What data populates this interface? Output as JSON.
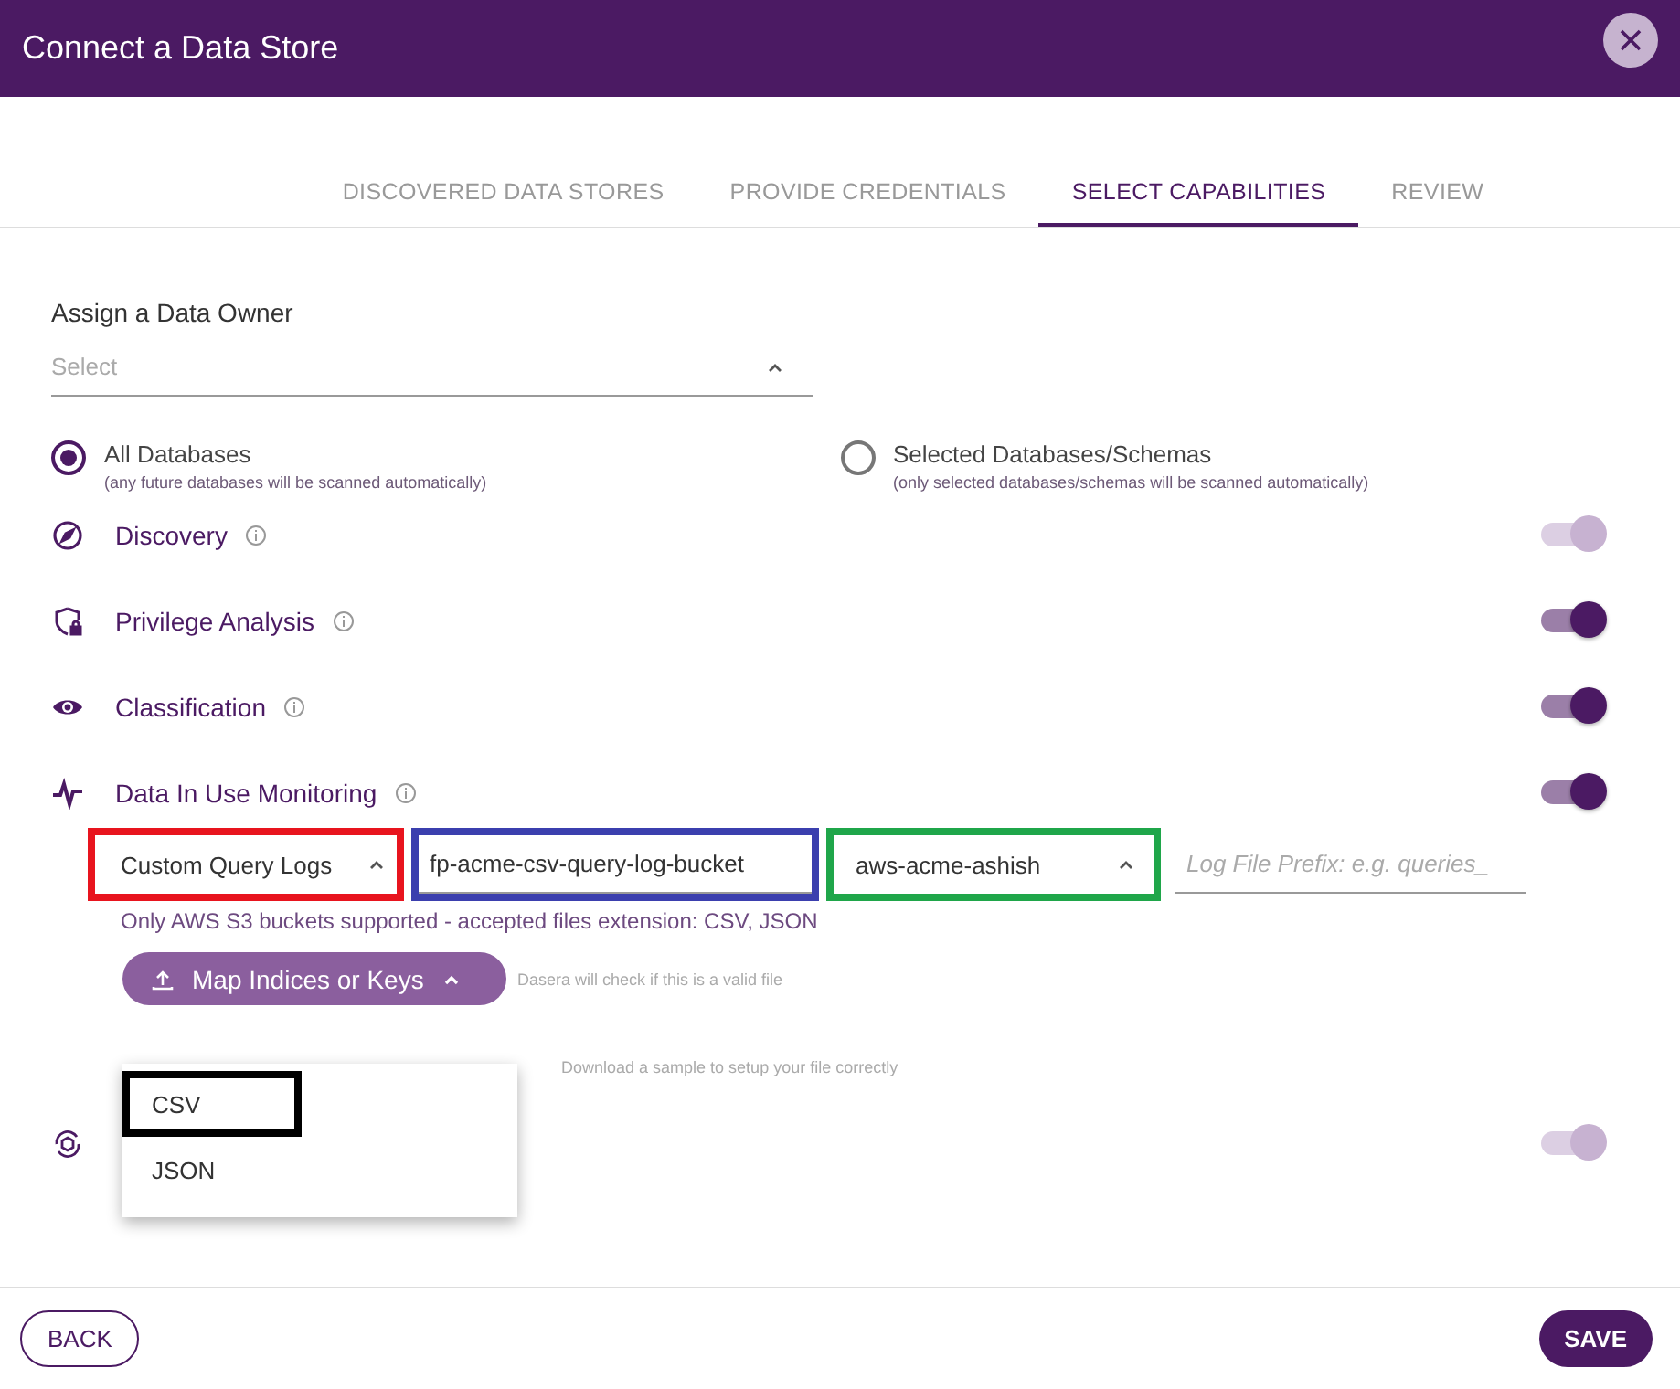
{
  "dialog": {
    "title": "Connect a Data Store"
  },
  "tabs": [
    {
      "label": "DISCOVERED DATA STORES",
      "selected": false
    },
    {
      "label": "PROVIDE CREDENTIALS",
      "selected": false
    },
    {
      "label": "SELECT CAPABILITIES",
      "selected": true
    },
    {
      "label": "REVIEW",
      "selected": false
    }
  ],
  "owner": {
    "label": "Assign a Data Owner",
    "placeholder": "Select"
  },
  "scope": [
    {
      "label": "All Databases",
      "note": "(any future databases will be scanned automatically)",
      "selected": true
    },
    {
      "label": "Selected Databases/Schemas",
      "note": "(only selected databases/schemas will be scanned automatically)",
      "selected": false
    }
  ],
  "capabilities": [
    {
      "label": "Discovery",
      "info": true,
      "on": true,
      "disabled": true
    },
    {
      "label": "Privilege Analysis",
      "info": true,
      "on": true,
      "disabled": false
    },
    {
      "label": "Classification",
      "info": true,
      "on": true,
      "disabled": false
    },
    {
      "label": "Data In Use Monitoring",
      "info": true,
      "on": true,
      "disabled": false,
      "config": true
    },
    {
      "on": true,
      "disabled": true
    }
  ],
  "monitoring": {
    "fields": [
      {
        "kind": "select",
        "value": "Custom Query Logs",
        "color": "#e8141e"
      },
      {
        "kind": "input",
        "value": "fp-acme-csv-query-log-bucket",
        "color": "#3b3fae"
      },
      {
        "kind": "select",
        "value": "aws-acme-ashish",
        "color": "#1fa64a"
      },
      {
        "kind": "input",
        "placeholder": "Log File Prefix: e.g. queries_"
      }
    ],
    "help": "Only AWS S3 buckets supported - accepted files extension: CSV, JSON",
    "map_button": "Map Indices or Keys",
    "check_hint": "Dasera will check if this is a valid file",
    "sample_hint": "Download a sample to setup your file correctly",
    "menu": [
      {
        "label": "CSV",
        "color": "#000000"
      },
      {
        "label": "JSON"
      }
    ]
  },
  "footer": {
    "back": "BACK",
    "save": "SAVE"
  }
}
